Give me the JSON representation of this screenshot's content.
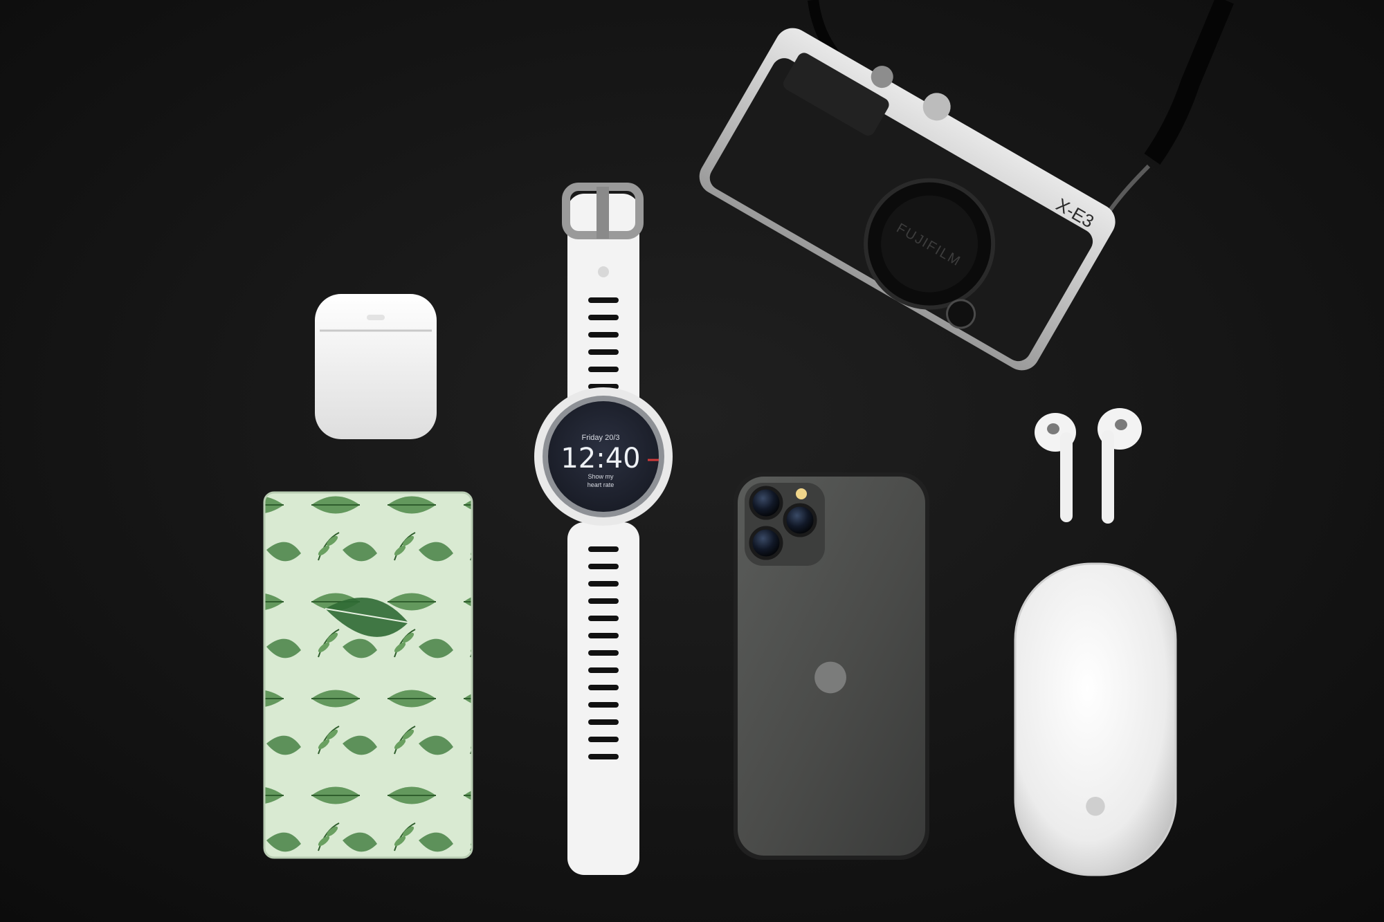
{
  "scene": {
    "background_color": "#141414"
  },
  "watch": {
    "date": "Friday 20/3",
    "time": "12:40",
    "prompt_line1": "Show my",
    "prompt_line2": "heart rate"
  },
  "camera": {
    "model": "X-E3",
    "brand": "FUJIFILM"
  },
  "phone": {
    "logo": "apple-logo-icon"
  },
  "mouse": {
    "logo": "apple-logo-icon"
  },
  "powerbank": {
    "pattern": "tropical-leaf-pattern",
    "base_color": "#d9ead2"
  }
}
